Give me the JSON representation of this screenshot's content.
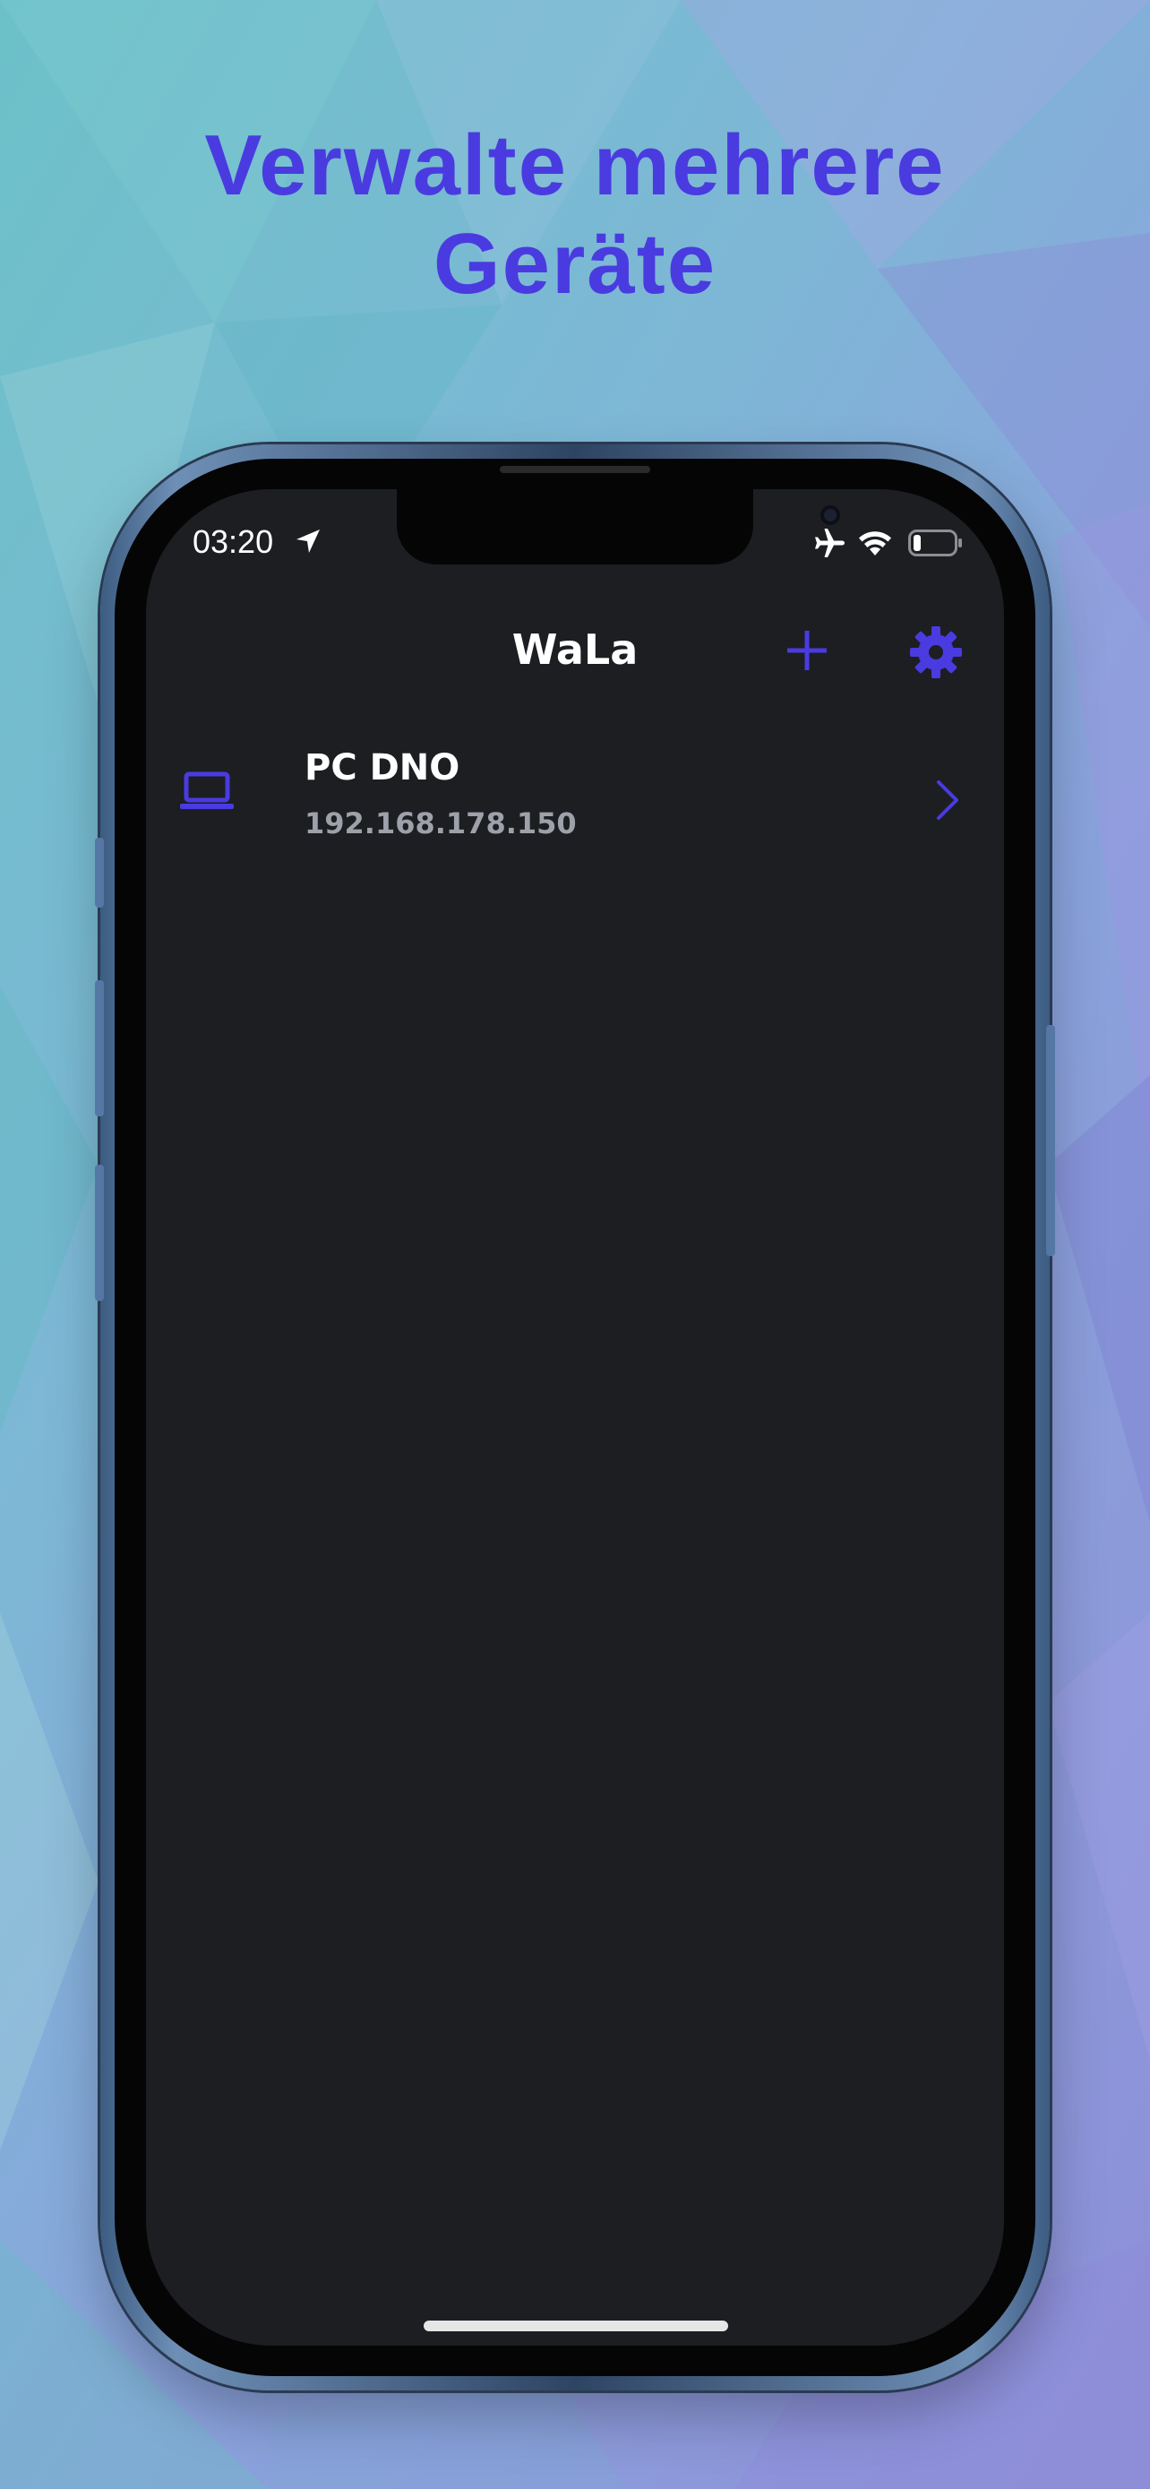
{
  "headline": {
    "line1": "Verwalte mehrere",
    "line2": "Geräte"
  },
  "status_bar": {
    "time": "03:20",
    "icons": [
      "location-arrow-icon",
      "airplane-icon",
      "wifi-icon",
      "battery-icon"
    ]
  },
  "nav": {
    "title": "WaLa",
    "add_icon": "plus-icon",
    "settings_icon": "gear-icon"
  },
  "devices": [
    {
      "name": "PC DNO",
      "ip": "192.168.178.150",
      "icon": "laptop-icon"
    }
  ],
  "colors": {
    "accent": "#4a3be0",
    "screen_bg": "#1c1e22",
    "secondary_text": "#9ea1a9"
  }
}
